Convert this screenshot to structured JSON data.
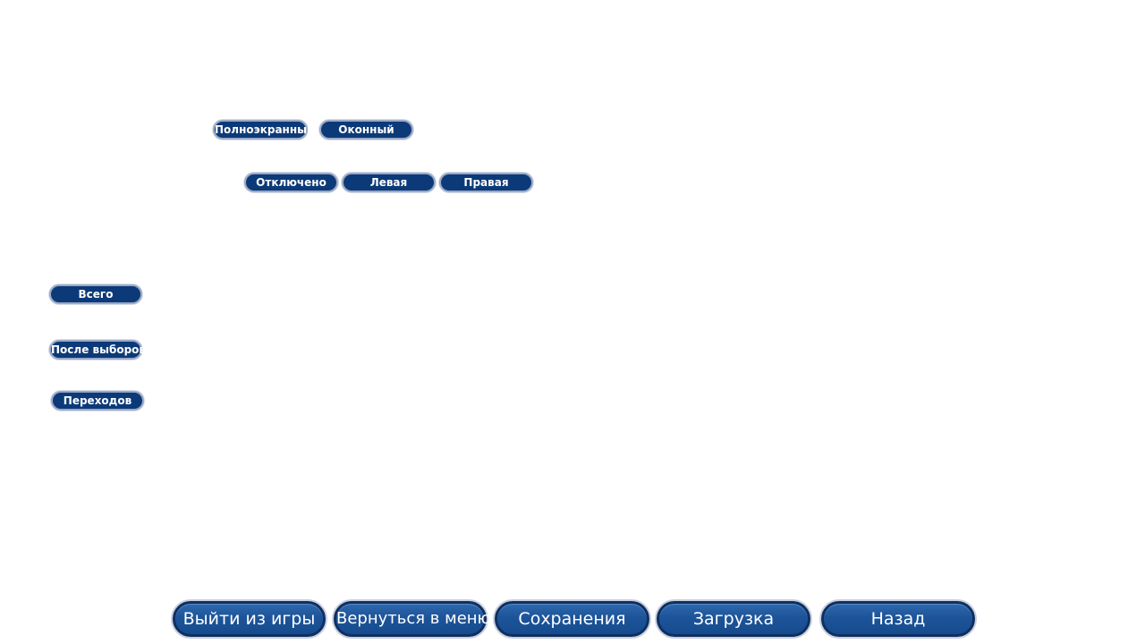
{
  "display": {
    "options": [
      "Полноэкранный",
      "Оконный"
    ]
  },
  "side": {
    "options": [
      "Отключено",
      "Левая",
      "Правая"
    ]
  },
  "skip": {
    "options": [
      "Всего",
      "После выборов",
      "Переходов"
    ]
  },
  "nav": {
    "quit": "Выйти из игры",
    "main_menu": "Вернуться в меню",
    "saves": "Сохранения",
    "load": "Загрузка",
    "back": "Назад"
  },
  "colors": {
    "button_fill": "#0c3a78",
    "nav_fill": "#1d5499",
    "background": "#ffffff"
  }
}
